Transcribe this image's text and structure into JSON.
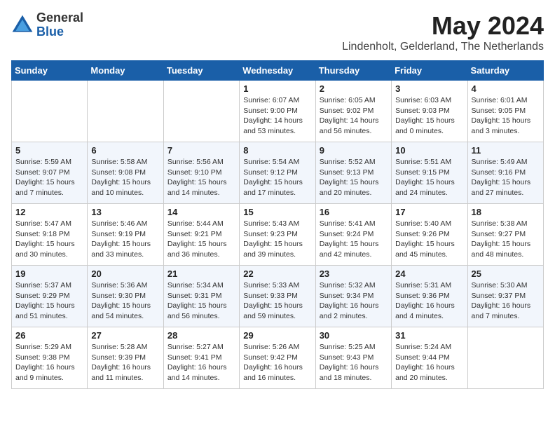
{
  "header": {
    "logo_general": "General",
    "logo_blue": "Blue",
    "month_title": "May 2024",
    "location": "Lindenholt, Gelderland, The Netherlands"
  },
  "weekdays": [
    "Sunday",
    "Monday",
    "Tuesday",
    "Wednesday",
    "Thursday",
    "Friday",
    "Saturday"
  ],
  "weeks": [
    [
      {
        "day": "",
        "info": ""
      },
      {
        "day": "",
        "info": ""
      },
      {
        "day": "",
        "info": ""
      },
      {
        "day": "1",
        "info": "Sunrise: 6:07 AM\nSunset: 9:00 PM\nDaylight: 14 hours and 53 minutes."
      },
      {
        "day": "2",
        "info": "Sunrise: 6:05 AM\nSunset: 9:02 PM\nDaylight: 14 hours and 56 minutes."
      },
      {
        "day": "3",
        "info": "Sunrise: 6:03 AM\nSunset: 9:03 PM\nDaylight: 15 hours and 0 minutes."
      },
      {
        "day": "4",
        "info": "Sunrise: 6:01 AM\nSunset: 9:05 PM\nDaylight: 15 hours and 3 minutes."
      }
    ],
    [
      {
        "day": "5",
        "info": "Sunrise: 5:59 AM\nSunset: 9:07 PM\nDaylight: 15 hours and 7 minutes."
      },
      {
        "day": "6",
        "info": "Sunrise: 5:58 AM\nSunset: 9:08 PM\nDaylight: 15 hours and 10 minutes."
      },
      {
        "day": "7",
        "info": "Sunrise: 5:56 AM\nSunset: 9:10 PM\nDaylight: 15 hours and 14 minutes."
      },
      {
        "day": "8",
        "info": "Sunrise: 5:54 AM\nSunset: 9:12 PM\nDaylight: 15 hours and 17 minutes."
      },
      {
        "day": "9",
        "info": "Sunrise: 5:52 AM\nSunset: 9:13 PM\nDaylight: 15 hours and 20 minutes."
      },
      {
        "day": "10",
        "info": "Sunrise: 5:51 AM\nSunset: 9:15 PM\nDaylight: 15 hours and 24 minutes."
      },
      {
        "day": "11",
        "info": "Sunrise: 5:49 AM\nSunset: 9:16 PM\nDaylight: 15 hours and 27 minutes."
      }
    ],
    [
      {
        "day": "12",
        "info": "Sunrise: 5:47 AM\nSunset: 9:18 PM\nDaylight: 15 hours and 30 minutes."
      },
      {
        "day": "13",
        "info": "Sunrise: 5:46 AM\nSunset: 9:19 PM\nDaylight: 15 hours and 33 minutes."
      },
      {
        "day": "14",
        "info": "Sunrise: 5:44 AM\nSunset: 9:21 PM\nDaylight: 15 hours and 36 minutes."
      },
      {
        "day": "15",
        "info": "Sunrise: 5:43 AM\nSunset: 9:23 PM\nDaylight: 15 hours and 39 minutes."
      },
      {
        "day": "16",
        "info": "Sunrise: 5:41 AM\nSunset: 9:24 PM\nDaylight: 15 hours and 42 minutes."
      },
      {
        "day": "17",
        "info": "Sunrise: 5:40 AM\nSunset: 9:26 PM\nDaylight: 15 hours and 45 minutes."
      },
      {
        "day": "18",
        "info": "Sunrise: 5:38 AM\nSunset: 9:27 PM\nDaylight: 15 hours and 48 minutes."
      }
    ],
    [
      {
        "day": "19",
        "info": "Sunrise: 5:37 AM\nSunset: 9:29 PM\nDaylight: 15 hours and 51 minutes."
      },
      {
        "day": "20",
        "info": "Sunrise: 5:36 AM\nSunset: 9:30 PM\nDaylight: 15 hours and 54 minutes."
      },
      {
        "day": "21",
        "info": "Sunrise: 5:34 AM\nSunset: 9:31 PM\nDaylight: 15 hours and 56 minutes."
      },
      {
        "day": "22",
        "info": "Sunrise: 5:33 AM\nSunset: 9:33 PM\nDaylight: 15 hours and 59 minutes."
      },
      {
        "day": "23",
        "info": "Sunrise: 5:32 AM\nSunset: 9:34 PM\nDaylight: 16 hours and 2 minutes."
      },
      {
        "day": "24",
        "info": "Sunrise: 5:31 AM\nSunset: 9:36 PM\nDaylight: 16 hours and 4 minutes."
      },
      {
        "day": "25",
        "info": "Sunrise: 5:30 AM\nSunset: 9:37 PM\nDaylight: 16 hours and 7 minutes."
      }
    ],
    [
      {
        "day": "26",
        "info": "Sunrise: 5:29 AM\nSunset: 9:38 PM\nDaylight: 16 hours and 9 minutes."
      },
      {
        "day": "27",
        "info": "Sunrise: 5:28 AM\nSunset: 9:39 PM\nDaylight: 16 hours and 11 minutes."
      },
      {
        "day": "28",
        "info": "Sunrise: 5:27 AM\nSunset: 9:41 PM\nDaylight: 16 hours and 14 minutes."
      },
      {
        "day": "29",
        "info": "Sunrise: 5:26 AM\nSunset: 9:42 PM\nDaylight: 16 hours and 16 minutes."
      },
      {
        "day": "30",
        "info": "Sunrise: 5:25 AM\nSunset: 9:43 PM\nDaylight: 16 hours and 18 minutes."
      },
      {
        "day": "31",
        "info": "Sunrise: 5:24 AM\nSunset: 9:44 PM\nDaylight: 16 hours and 20 minutes."
      },
      {
        "day": "",
        "info": ""
      }
    ]
  ]
}
